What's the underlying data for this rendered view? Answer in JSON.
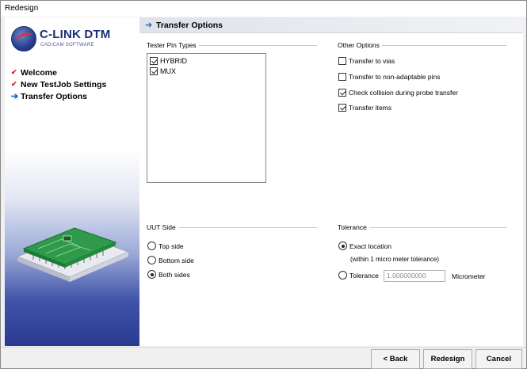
{
  "window": {
    "title": "Redesign"
  },
  "sidebar": {
    "logo_text": "C-LINK DTM",
    "logo_sub": "CAD/CAM SOFTWARE",
    "steps": [
      {
        "label": "Welcome",
        "state": "done"
      },
      {
        "label": "New TestJob Settings",
        "state": "done"
      },
      {
        "label": "Transfer Options",
        "state": "current"
      }
    ]
  },
  "header": {
    "title": "Transfer Options"
  },
  "tester_pin_types": {
    "title": "Tester Pin Types",
    "items": [
      {
        "label": "HYBRID",
        "checked": true
      },
      {
        "label": "MUX",
        "checked": true
      }
    ]
  },
  "other_options": {
    "title": "Other Options",
    "items": [
      {
        "label": "Transfer to vias",
        "checked": false
      },
      {
        "label": "Transfer to non-adaptable pins",
        "checked": false
      },
      {
        "label": "Check collision during probe transfer",
        "checked": true
      },
      {
        "label": "Transfer items",
        "checked": true
      }
    ]
  },
  "uut_side": {
    "title": "UUT Side",
    "options": [
      {
        "label": "Top side",
        "selected": false
      },
      {
        "label": "Bottom side",
        "selected": false
      },
      {
        "label": "Both sides",
        "selected": true
      }
    ]
  },
  "tolerance": {
    "title": "Tolerance",
    "exact_label": "Exact location",
    "exact_note": "(within 1 micro meter tolerance)",
    "tolerance_label": "Tolerance",
    "value": "1.000000000",
    "unit": "Micrometer",
    "selected": "exact"
  },
  "footer": {
    "back_label": "< Back",
    "redesign_label": "Redesign",
    "cancel_label": "Cancel"
  },
  "colors": {
    "accent": "#1c5fcf",
    "check": "#d0202a",
    "sidebar_dark": "#2a3990"
  }
}
